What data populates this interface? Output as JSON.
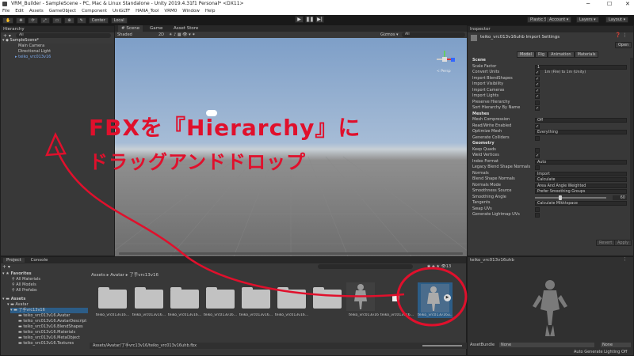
{
  "window": {
    "title": "VRM_Builder - SampleScene - PC, Mac & Linux Standalone - Unity 2019.4.31f1 Personal* <DX11>",
    "minimize": "─",
    "maximize": "☐",
    "close": "✕"
  },
  "menu": [
    "File",
    "Edit",
    "Assets",
    "GameObject",
    "Component",
    "UniGLTF",
    "HANA_Tool",
    "VRM0",
    "Window",
    "Help"
  ],
  "toolbar": {
    "tools": [
      "✋",
      "✥",
      "⟳",
      "⤢",
      "▭",
      "⊕",
      "✎"
    ],
    "center": "Center",
    "local": "Local",
    "plastic": "Plastic SCM",
    "account": "Account ▾",
    "layers": "Layers ▾",
    "layout": "Layout ▾"
  },
  "hierarchy": {
    "tab": "Hierarchy",
    "search": "All",
    "items": [
      "SampleScene*",
      "Main Camera",
      "Directional Light",
      "teiko_vrc013v16"
    ]
  },
  "scene": {
    "tabs": [
      "# Scene",
      "Game",
      "Asset Store"
    ],
    "shading": "Shaded",
    "mode": "2D",
    "gizmos": "Gizmos ▾",
    "search": "All",
    "persp": "< Persp"
  },
  "annotation": {
    "line1": "FBXを『Hierarchy』に",
    "line2": "ドラッグアンドドロップ"
  },
  "inspector": {
    "tab": "Inspector",
    "title": "teiko_vrc013v16uhb Import Settings",
    "open": "Open",
    "tabs": [
      "Model",
      "Rig",
      "Animation",
      "Materials"
    ],
    "rows": [
      {
        "k": "hdr",
        "label": "Scene"
      },
      {
        "k": "val",
        "label": "Scale Factor",
        "value": "1"
      },
      {
        "k": "chk",
        "label": "Convert Units",
        "value": "✓",
        "extra": "1m (File) to 1m (Unity)"
      },
      {
        "k": "chk",
        "label": "Import BlendShapes",
        "value": "✓"
      },
      {
        "k": "chk",
        "label": "Import Visibility",
        "value": "✓"
      },
      {
        "k": "chk",
        "label": "Import Cameras",
        "value": "✓"
      },
      {
        "k": "chk",
        "label": "Import Lights",
        "value": "✓"
      },
      {
        "k": "chk",
        "label": "Preserve Hierarchy",
        "value": ""
      },
      {
        "k": "chk",
        "label": "Sort Hierarchy By Name",
        "value": "✓"
      },
      {
        "k": "hdr",
        "label": "Meshes"
      },
      {
        "k": "val",
        "label": "Mesh Compression",
        "value": "Off"
      },
      {
        "k": "chk",
        "label": "Read/Write Enabled",
        "value": "✓"
      },
      {
        "k": "val",
        "label": "Optimize Mesh",
        "value": "Everything"
      },
      {
        "k": "chk",
        "label": "Generate Colliders",
        "value": ""
      },
      {
        "k": "hdr",
        "label": "Geometry"
      },
      {
        "k": "chk",
        "label": "Keep Quads",
        "value": ""
      },
      {
        "k": "chk",
        "label": "Weld Vertices",
        "value": "✓"
      },
      {
        "k": "val",
        "label": "Index Format",
        "value": "Auto"
      },
      {
        "k": "chk",
        "label": "Legacy Blend Shape Normals",
        "value": ""
      },
      {
        "k": "val",
        "label": "Normals",
        "value": "Import"
      },
      {
        "k": "val",
        "label": "Blend Shape Normals",
        "value": "Calculate"
      },
      {
        "k": "val",
        "label": "Normals Mode",
        "value": "Area And Angle Weighted"
      },
      {
        "k": "val",
        "label": "Smoothness Source",
        "value": "Prefer Smoothing Groups"
      },
      {
        "k": "sld",
        "label": "Smoothing Angle",
        "value": "60"
      },
      {
        "k": "val",
        "label": "Tangents",
        "value": "Calculate Mikktspace"
      },
      {
        "k": "chk",
        "label": "Swap UVs",
        "value": ""
      },
      {
        "k": "chk",
        "label": "Generate Lightmap UVs",
        "value": ""
      }
    ],
    "revert": "Revert",
    "apply": "Apply",
    "preview_title": "teiko_vrc013v16uhb",
    "assetbundle_label": "AssetBundle",
    "assetbundle_value": "None",
    "assetbundle_variant": "None",
    "auto_gen": "Auto Generate Lighting Off"
  },
  "project": {
    "tabs": [
      "Project",
      "Console"
    ],
    "favorites": {
      "label": "Favorites",
      "items": [
        "All Materials",
        "All Models",
        "All Prefabs"
      ]
    },
    "assets": {
      "label": "Assets",
      "items": [
        "Avatar",
        "了手vrc13v16",
        "teiko_vrc013v16.Avatar",
        "teiko_vrc013v16.AvatarDescript",
        "teiko_vrc013v16.BlendShapes",
        "teiko_vrc013v16.Materials",
        "teiko_vrc013v16.MetaObject",
        "teiko_vrc013v16.Textures"
      ]
    },
    "breadcrumb": [
      "Assets",
      "Avatar",
      "了手vrc13v16"
    ],
    "count": "13",
    "files": [
      "teiko_vrc013v16...",
      "teiko_vrc013v16...",
      "teiko_vrc013v16...",
      "teiko_vrc013v16...",
      "teiko_vrc013v16...",
      "teiko_vrc013v16...",
      "teiko_vrc013v16",
      "teiko_vrc013v16...",
      "teiko_vrc013v16u..."
    ],
    "status_path": "Assets/Avatar/了手vrc13v16/teiko_vrc013v16uhb.fbx"
  }
}
